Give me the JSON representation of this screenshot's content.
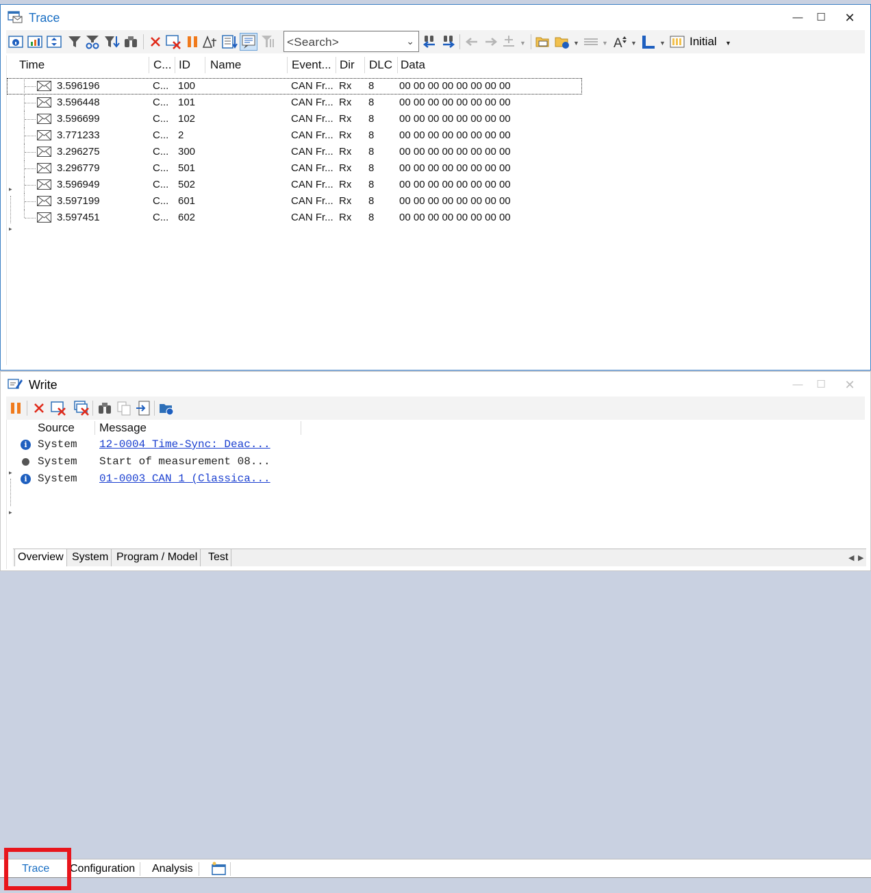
{
  "trace": {
    "title": "Trace",
    "search_placeholder": "<Search>",
    "layout_label": "Initial",
    "columns": [
      "Time",
      "C...",
      "ID",
      "Name",
      "Event...",
      "Dir",
      "DLC",
      "Data"
    ],
    "rows": [
      {
        "time": "3.596196",
        "chn": "C...",
        "id": "100",
        "name": "",
        "event": "CAN Fr...",
        "dir": "Rx",
        "dlc": "8",
        "data": "00  00  00  00  00  00  00  00"
      },
      {
        "time": "3.596448",
        "chn": "C...",
        "id": "101",
        "name": "",
        "event": "CAN Fr...",
        "dir": "Rx",
        "dlc": "8",
        "data": "00  00  00  00  00  00  00  00"
      },
      {
        "time": "3.596699",
        "chn": "C...",
        "id": "102",
        "name": "",
        "event": "CAN Fr...",
        "dir": "Rx",
        "dlc": "8",
        "data": "00  00  00  00  00  00  00  00"
      },
      {
        "time": "3.771233",
        "chn": "C...",
        "id": "2",
        "name": "",
        "event": "CAN Fr...",
        "dir": "Rx",
        "dlc": "8",
        "data": "00  00  00  00  00  00  00  00"
      },
      {
        "time": "3.296275",
        "chn": "C...",
        "id": "300",
        "name": "",
        "event": "CAN Fr...",
        "dir": "Rx",
        "dlc": "8",
        "data": "00  00  00  00  00  00  00  00"
      },
      {
        "time": "3.296779",
        "chn": "C...",
        "id": "501",
        "name": "",
        "event": "CAN Fr...",
        "dir": "Rx",
        "dlc": "8",
        "data": "00  00  00  00  00  00  00  00"
      },
      {
        "time": "3.596949",
        "chn": "C...",
        "id": "502",
        "name": "",
        "event": "CAN Fr...",
        "dir": "Rx",
        "dlc": "8",
        "data": "00  00  00  00  00  00  00  00"
      },
      {
        "time": "3.597199",
        "chn": "C...",
        "id": "601",
        "name": "",
        "event": "CAN Fr...",
        "dir": "Rx",
        "dlc": "8",
        "data": "00  00  00  00  00  00  00  00"
      },
      {
        "time": "3.597451",
        "chn": "C...",
        "id": "602",
        "name": "",
        "event": "CAN Fr...",
        "dir": "Rx",
        "dlc": "8",
        "data": "00  00  00  00  00  00  00  00"
      }
    ]
  },
  "write": {
    "title": "Write",
    "columns": [
      "Source",
      "Message"
    ],
    "rows": [
      {
        "icon": "info-icon",
        "source": "System",
        "message": "12-0004 Time-Sync: Deac...",
        "link": true
      },
      {
        "icon": "bullet-icon",
        "source": "System",
        "message": "Start of measurement 08...",
        "link": false
      },
      {
        "icon": "info-icon",
        "source": "System",
        "message": "01-0003 CAN 1 (Classica...",
        "link": true
      }
    ],
    "tabs": [
      "Overview",
      "System",
      "Program / Model",
      "Test"
    ],
    "active_tab": "Overview"
  },
  "desktop_tabs": {
    "items": [
      "Trace",
      "Configuration",
      "Analysis"
    ],
    "active": "Trace"
  },
  "colors": {
    "accent": "#1a6fc4",
    "desktop_bg": "#c9d1e1",
    "highlight": "#e8151c",
    "link": "#1a3fd0"
  }
}
